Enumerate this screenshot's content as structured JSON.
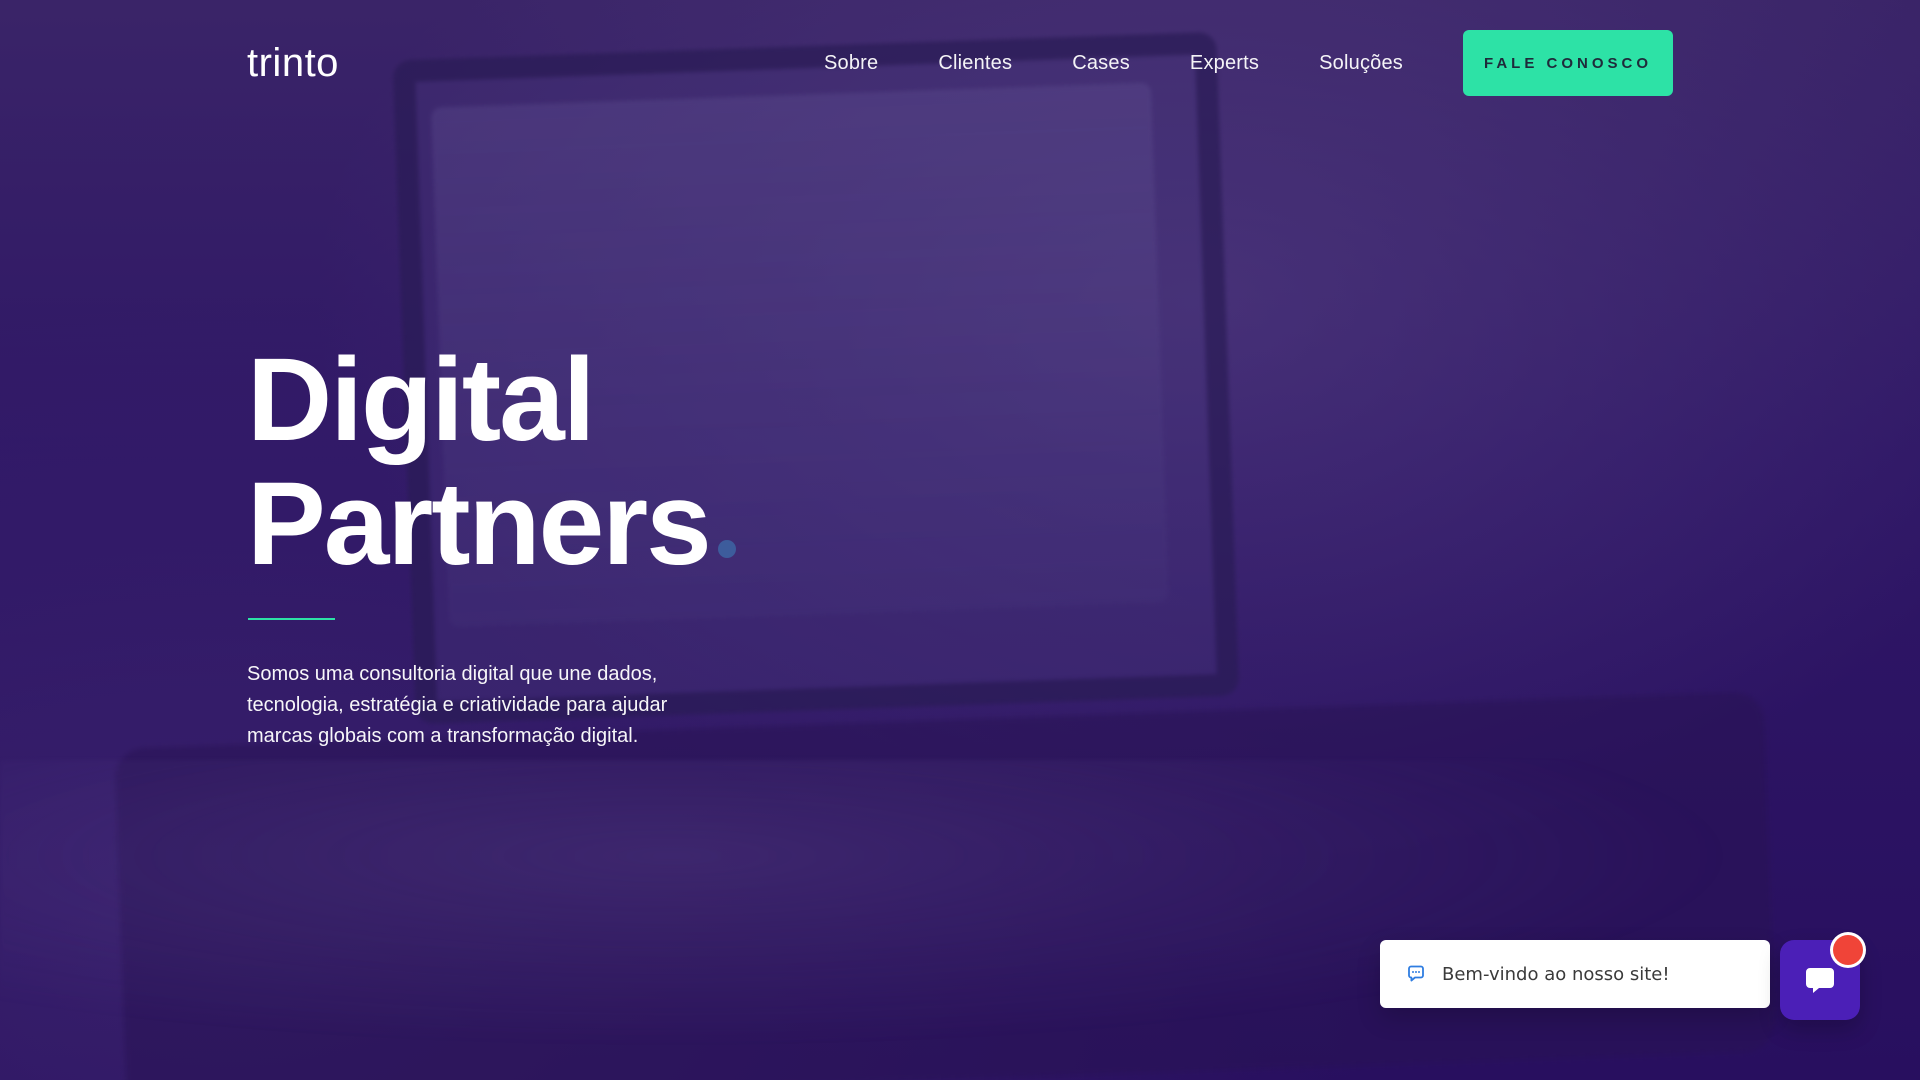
{
  "header": {
    "logo_text": "trinto",
    "nav": [
      {
        "label": "Sobre"
      },
      {
        "label": "Clientes"
      },
      {
        "label": "Cases"
      },
      {
        "label": "Experts"
      },
      {
        "label": "Soluções"
      }
    ],
    "cta_label": "FALE CONOSCO"
  },
  "hero": {
    "title_line_1": "Digital",
    "title_line_2": "Partners",
    "description": "Somos uma consultoria digital que une dados, tecnologia, estratégia e criatividade para ajudar marcas globais com a transformação digital."
  },
  "chat": {
    "welcome_text": "Bem-vindo ao nosso site!",
    "icons": {
      "message": "chat-bubble-icon",
      "launcher": "chat-icon"
    }
  },
  "colors": {
    "accent": "#2DE2A6",
    "background_dark": "#280F5F",
    "chat_button": "#4B1FB7",
    "notification": "#F04438"
  }
}
